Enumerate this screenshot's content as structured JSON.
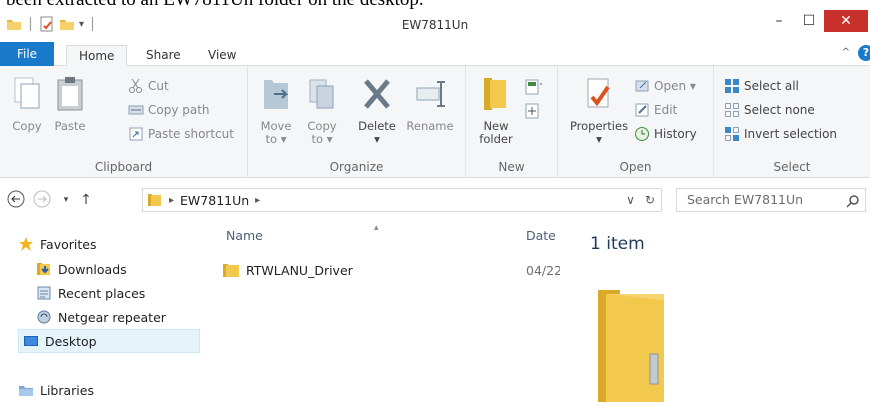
{
  "caption_fragment": "been extracted to an EW7811Un folder on the desktop.",
  "window": {
    "title": "EW7811Un",
    "controls": {
      "minimize": "–",
      "maximize": "☐",
      "close": "✕"
    },
    "help": "?"
  },
  "tabs": [
    "File",
    "Home",
    "Share",
    "View"
  ],
  "ribbon": {
    "clipboard": {
      "label": "Clipboard",
      "copy": "Copy",
      "paste": "Paste",
      "cut": "Cut",
      "copy_path": "Copy path",
      "paste_shortcut": "Paste shortcut"
    },
    "organize": {
      "label": "Organize",
      "move_to": [
        "Move",
        "to ▾"
      ],
      "copy_to": [
        "Copy",
        "to ▾"
      ],
      "delete": [
        "Delete",
        "▾"
      ],
      "rename": "Rename"
    },
    "new": {
      "label": "New",
      "new_folder": [
        "New",
        "folder"
      ]
    },
    "open": {
      "label": "Open",
      "properties": [
        "Properties",
        "▾"
      ],
      "open": "Open ▾",
      "edit": "Edit",
      "history": "History"
    },
    "select": {
      "label": "Select",
      "select_all": "Select all",
      "select_none": "Select none",
      "invert_selection": "Invert selection"
    }
  },
  "address": {
    "crumbs": [
      "EW7811Un"
    ],
    "search_placeholder": "Search EW7811Un"
  },
  "nav": {
    "favorites": "Favorites",
    "items": [
      "Downloads",
      "Recent places",
      "Netgear repeater",
      "Desktop"
    ],
    "libraries": "Libraries"
  },
  "columns": {
    "name": "Name",
    "date": "Date"
  },
  "files": [
    {
      "name": "RTWLANU_Driver",
      "date": "04/22"
    }
  ],
  "preview": {
    "count": "1 item"
  },
  "colors": {
    "file_tab": "#1979ca",
    "close_button": "#c7302b",
    "folder_yellow": "#f2c94c",
    "selection": "#e5f3fb"
  }
}
